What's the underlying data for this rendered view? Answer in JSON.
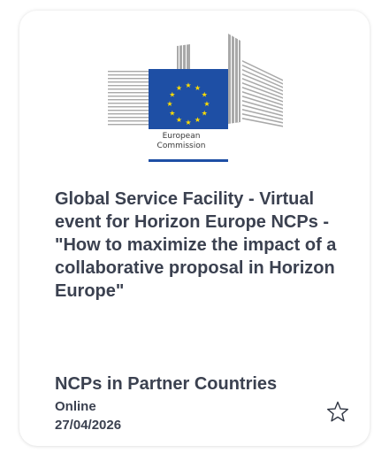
{
  "logo": {
    "line1": "European",
    "line2": "Commission",
    "flag_color": "#1e4fa5",
    "star_color": "#ffdd00",
    "underline_color": "#1e4fa5",
    "icon": "european-commission-logo"
  },
  "event": {
    "title": "Global Service Facility - Virtual event for Horizon Europe NCPs - \"How to maximize the impact of a collaborative proposal in Horizon Europe\"",
    "category": "NCPs in Partner Countries",
    "location": "Online",
    "date": "27/04/2026"
  },
  "actions": {
    "favorite_icon": "star-outline-icon"
  },
  "colors": {
    "text": "#3b4150",
    "card_bg": "#ffffff"
  }
}
